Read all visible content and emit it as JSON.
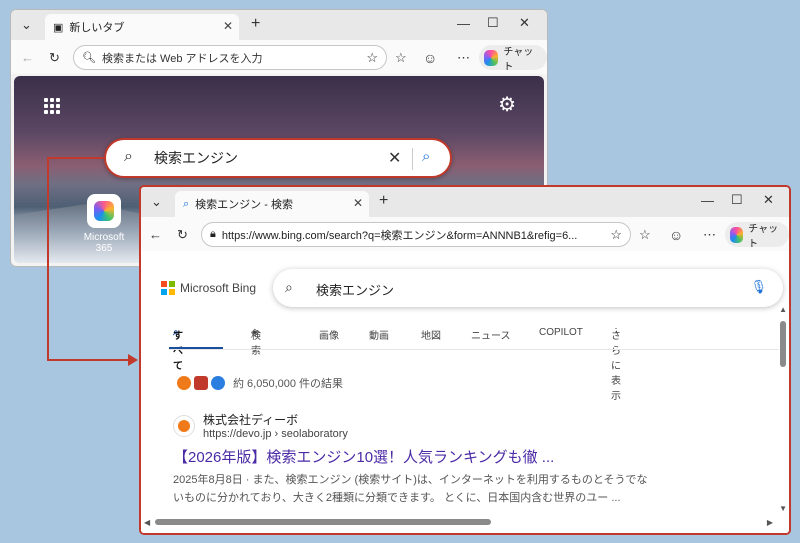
{
  "window1": {
    "tab_title": "新しいタブ",
    "address_placeholder": "検索または Web アドレスを入力",
    "chat_label": "チャット",
    "ntp_search_text": "検索エンジン",
    "app_label": "Microsoft 365"
  },
  "window2": {
    "tab_title": "検索エンジン - 検索",
    "url": "https://www.bing.com/search?q=検索エンジン&form=ANNNB1&refig=6...",
    "chat_label": "チャット",
    "bing_logo_text": "Microsoft Bing",
    "search_text": "検索エンジン",
    "nav": {
      "all": "すべて",
      "search": "検索",
      "images": "画像",
      "videos": "動画",
      "maps": "地図",
      "news": "ニュース",
      "copilot": "COPILOT",
      "more": "さらに表示"
    },
    "result_count": "約 6,050,000 件の結果",
    "result": {
      "site_name": "株式会社ディーボ",
      "site_url": "https://devo.jp › seolaboratory",
      "title": "【2026年版】検索エンジン10選！人気ランキングも徹 ...",
      "desc_line1": "2025年8月8日 · また、検索エンジン (検索サイト)は、インターネットを利用するものとそうでな",
      "desc_line2": "いものに分かれており、大きく2種類に分類できます。 とくに、日本国内含む世界のユー ..."
    }
  },
  "colors": {
    "highlight": "#c0392b",
    "link": "#4b2aa6",
    "accent": "#1a6fd8"
  }
}
